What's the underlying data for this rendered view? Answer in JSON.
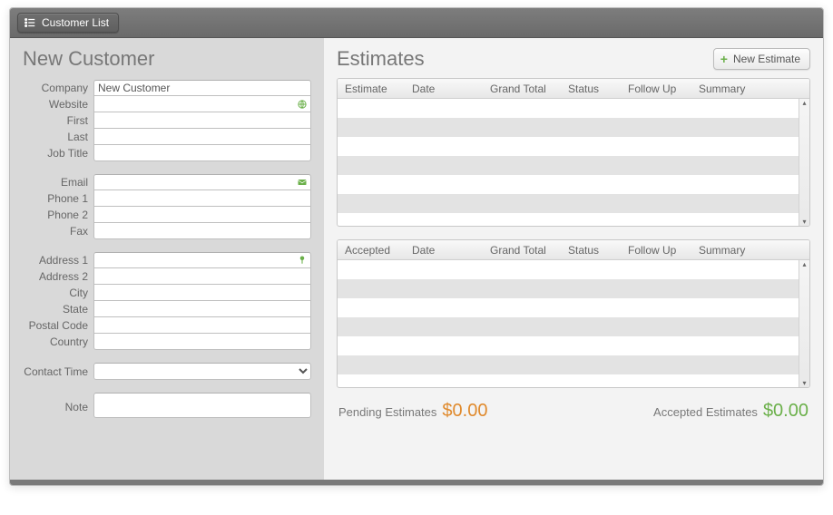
{
  "toolbar": {
    "customer_list_label": "Customer List"
  },
  "leftPanel": {
    "title": "New Customer",
    "fields": {
      "company_label": "Company",
      "company_value": "New Customer",
      "website_label": "Website",
      "website_value": "",
      "first_label": "First",
      "first_value": "",
      "last_label": "Last",
      "last_value": "",
      "jobtitle_label": "Job Title",
      "jobtitle_value": "",
      "email_label": "Email",
      "email_value": "",
      "phone1_label": "Phone 1",
      "phone1_value": "",
      "phone2_label": "Phone 2",
      "phone2_value": "",
      "fax_label": "Fax",
      "fax_value": "",
      "address1_label": "Address 1",
      "address1_value": "",
      "address2_label": "Address 2",
      "address2_value": "",
      "city_label": "City",
      "city_value": "",
      "state_label": "State",
      "state_value": "",
      "postal_label": "Postal Code",
      "postal_value": "",
      "country_label": "Country",
      "country_value": "",
      "contacttime_label": "Contact Time",
      "contacttime_value": "",
      "note_label": "Note",
      "note_value": ""
    }
  },
  "rightPanel": {
    "title": "Estimates",
    "new_estimate_label": "New Estimate",
    "grid1": {
      "columns": [
        "Estimate",
        "Date",
        "Grand Total",
        "Status",
        "Follow Up",
        "Summary"
      ],
      "rows": []
    },
    "grid2": {
      "columns": [
        "Accepted",
        "Date",
        "Grand Total",
        "Status",
        "Follow Up",
        "Summary"
      ],
      "rows": []
    },
    "totals": {
      "pending_label": "Pending Estimates",
      "pending_amount": "$0.00",
      "accepted_label": "Accepted Estimates",
      "accepted_amount": "$0.00"
    }
  }
}
